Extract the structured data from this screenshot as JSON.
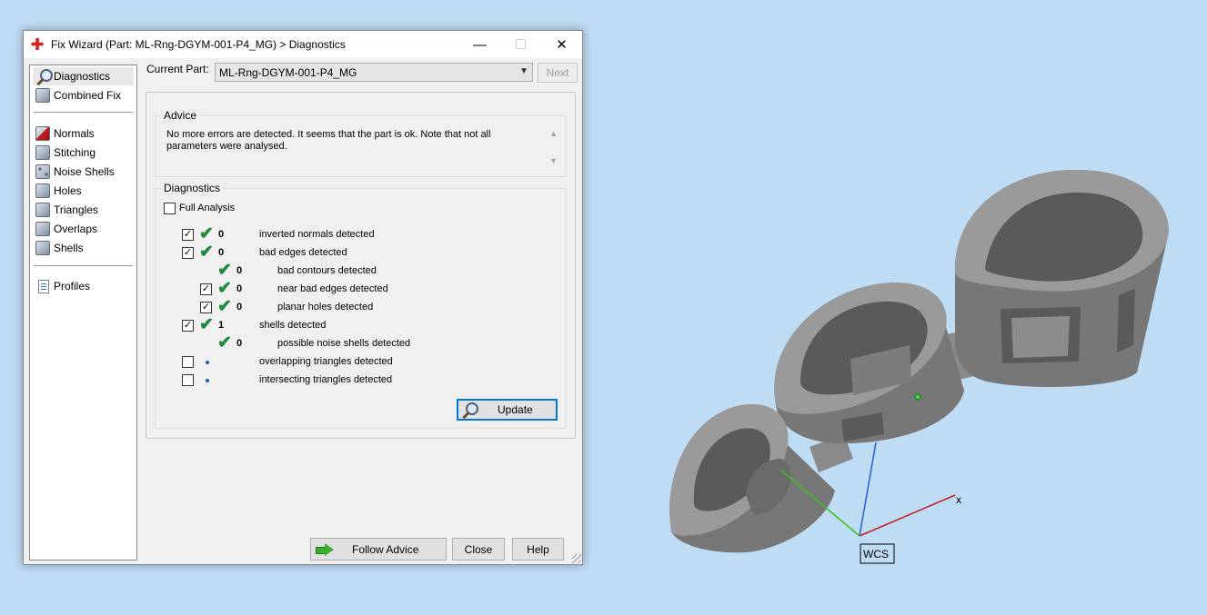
{
  "window": {
    "title": "Fix Wizard (Part: ML-Rng-DGYM-001-P4_MG) > Diagnostics",
    "minimize": "—",
    "maximize": "☐",
    "close": "✕"
  },
  "sidebar": {
    "items": [
      {
        "label": "Diagnostics",
        "icon": "magnifier-icon"
      },
      {
        "label": "Combined Fix",
        "icon": "cube-icon"
      },
      {
        "label": "Normals",
        "icon": "normals-cube-icon"
      },
      {
        "label": "Stitching",
        "icon": "stitching-cube-icon"
      },
      {
        "label": "Noise Shells",
        "icon": "noise-shells-icon"
      },
      {
        "label": "Holes",
        "icon": "holes-cube-icon"
      },
      {
        "label": "Triangles",
        "icon": "triangles-cube-icon"
      },
      {
        "label": "Overlaps",
        "icon": "overlaps-cube-icon"
      },
      {
        "label": "Shells",
        "icon": "shells-cube-icon"
      },
      {
        "label": "Profiles",
        "icon": "document-icon"
      }
    ]
  },
  "part": {
    "label": "Current Part:",
    "value": "ML-Rng-DGYM-001-P4_MG",
    "next": "Next"
  },
  "advice": {
    "title": "Advice",
    "text": "No more errors are detected. It seems that the part is ok. Note that not all parameters were analysed."
  },
  "diagnostics": {
    "title": "Diagnostics",
    "full_analysis": "Full Analysis",
    "rows": [
      {
        "count": "0",
        "label": "inverted normals detected"
      },
      {
        "count": "0",
        "label": "bad edges detected"
      },
      {
        "count": "0",
        "label": "bad contours detected"
      },
      {
        "count": "0",
        "label": "near bad edges detected"
      },
      {
        "count": "0",
        "label": "planar holes detected"
      },
      {
        "count": "1",
        "label": "shells detected"
      },
      {
        "count": "0",
        "label": "possible noise shells detected"
      },
      {
        "count": "",
        "label": "overlapping triangles detected"
      },
      {
        "count": "",
        "label": "intersecting triangles detected"
      }
    ],
    "update": "Update"
  },
  "footer": {
    "follow_advice": "Follow Advice",
    "close": "Close",
    "help": "Help"
  },
  "viewport": {
    "wcs": "WCS",
    "axis_x": "x",
    "background": "#bfdcf5",
    "model_color": "#7c7c7c"
  }
}
